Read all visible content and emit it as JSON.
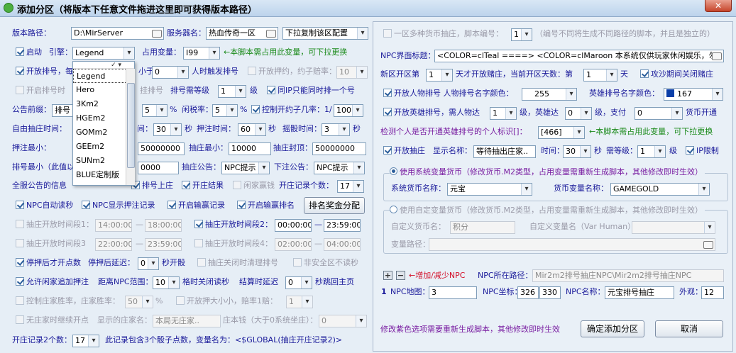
{
  "window": {
    "title": "添加分区（将版本下任意文件拖进这里即可获得版本路径）",
    "close": "✕"
  },
  "left": {
    "version_path_label": "版本路径：",
    "version_path": "D:\\MirServer",
    "server_name_label": "服务器名：",
    "server_name": "热血传奇一区",
    "copy_config": "下拉复制该区配置",
    "start_label": "启动",
    "engine_label": "引擎：",
    "engine": "Legend",
    "occupy_var_label": "占用变量：",
    "occupy_var": "I99",
    "occupy_note": "←本脚本需占用此变量，可下拉更换",
    "open_rank_label": "开放排号，每",
    "trigger_label": "小于",
    "trigger_value": "0",
    "trigger_note": "人时触发排号",
    "open_bet_label": "开放押约，约子赔率：",
    "bet_odds": "10",
    "enable_rank2_label": "开启排号时",
    "hang_label": "挂排号",
    "rank_level_label": "排号需等级",
    "rank_level": "1",
    "level_unit": "级",
    "same_ip_label": "同IP只能同时排一个号",
    "notice_label": "公告前缀：",
    "notice_value": "排号",
    "pct1": "5",
    "pct_unit": "%",
    "idle_rate_label": "闲税率：",
    "idle_rate": "5",
    "control_label": "控制开约子几率：1/",
    "control_value": "100",
    "free_label": "自由抽庄时间：",
    "time_label": "间：",
    "time1": "30",
    "sec": "秒",
    "bet_time_label": "押注时间：",
    "bet_time": "60",
    "shake_time_label": "摇骰时间：",
    "shake_time": "3",
    "min_bet_label": "押注最小：",
    "max_bet_value": "50000000",
    "min_grab_label": "抽庄最小：",
    "min_grab": "10000",
    "grab_cap_label": "抽庄封顶：",
    "grab_cap": "50000000",
    "rank_min_label": "排号最小（此值以",
    "rank_min_value": "0000",
    "grab_notice_label": "抽庄公告：",
    "grab_notice": "NPC提示",
    "bottom_notice_label": "下注公告：",
    "bottom_notice": "NPC提示",
    "all_notice_label": "全服公告的信息",
    "rank_on_label": "排号上庄",
    "result_label": "开庄结果",
    "idle_label": "闲家赢钱",
    "record_count_label": "开庄记录个数：",
    "record_count": "17",
    "npc_auto_label": "NPC自动读秒",
    "npc_show_label": "NPC显示押注记录",
    "win_record_label": "开启输赢记录",
    "win_rank_label": "开启输赢排名",
    "rank_award_btn": "排名奖金分配",
    "period1_label": "抽庄开放时间段1：",
    "p1a": "14:00:00",
    "p1b": "18:00:00",
    "period2_label": "抽庄开放时间段2：",
    "p2a": "00:00:00",
    "p2b": "23:59:00",
    "period3_label": "抽庄开放时间段3",
    "p3a": "22:00:00",
    "p3b": "23:59:00",
    "period4_label": "抽庄开放时间段4：",
    "p4a": "02:00:00",
    "p4b": "04:00:00",
    "dash": "—",
    "stop_label": "停押后才开点数",
    "delay_label": "停押后延迟：",
    "delay": "0",
    "delay_unit": "秒开骰",
    "grab_clear_label": "抽庄关闭时清理排号",
    "non_owner_label": "非安全区不读秒",
    "allow_idle_label": "允许闲家追加押注",
    "npc_range_label": "距离NPC范围：",
    "npc_range": "10",
    "range_unit": "格时关闭读秒",
    "settle_label": "结算时延迟",
    "settle": "0",
    "settle_unit": "秒跳回主页",
    "ctrl_winrate_label": "控制庄家胜率，庄家胜率：",
    "ctrl_winrate": "50",
    "pct": "%",
    "open_size_label": "开放押大小小，赔率1赔：",
    "open_size": "1",
    "no_dealer_label": "无庄家时继续开点",
    "show_dealer_label": "显示的庄家名：",
    "show_dealer": "本局无庄家..",
    "dealer_money_label": "庄本钱（大于0系统坐庄）：",
    "dealer_money": "0",
    "record2_label": "开庄记录2个数：",
    "record2": "17",
    "record2_note": "此记录包含3个骰子点数，变量名为：<$GLOBAL(抽庄开庄记录2)>",
    "engine_options": [
      "Legend",
      "Hero",
      "3Km2",
      "HGEm2",
      "GOMm2",
      "GEEm2",
      "SUNm2",
      "BLUE定制版"
    ]
  },
  "right": {
    "multi_label": "一区多种货币抽庄，脚本编号：",
    "multi_value": "1",
    "multi_note": "（编号不同将生成不同路径的脚本，并且是独立的）",
    "npc_title_label": "NPC界面标题：",
    "npc_title": "<COLOR=clTeal ====> <COLOR=clMaroon 本系统仅供玩家休闲娱乐，勿",
    "new_zone_label": "新区开区第",
    "new_zone": "1",
    "open_day_label": "天才开放赌庄，当前开区天数：第",
    "open_day": "1",
    "day": "天",
    "siege_label": "攻沙期间关闭赌庄",
    "open_human_label": "开放人物排号 人物排号名字颜色：",
    "human_color": "255",
    "hero_color_label": "英雄排号名字颜色：",
    "hero_color": "167",
    "hero_color_hex": "#0b3fa8",
    "open_hero_label": "开放英雄排号，需人物达",
    "hero_lv1": "1",
    "hero_lv_mid": "级，英雄达",
    "hero_lv2": "0",
    "hero_pay_label": "级，支付",
    "hero_pay": "0",
    "currency_open": "货币开通",
    "detect_label": "检测个人是否开通英雄排号的个人标识[]：",
    "detect_value": "[466]",
    "detect_note": "←本脚本需占用此变量，可下拉更换",
    "open_grab_label": "开放抽庄",
    "display_name_label": "显示名称：",
    "display_name": "等待抽出庄家..",
    "time_label": "时间：",
    "time_value": "30",
    "sec": "秒",
    "need_level_label": "需等级：",
    "need_level": "1",
    "level": "级",
    "ip_limit_label": "IP限制",
    "sys_currency_radio": "使用系统变量货币（修改货币.M2类型，占用变量需重新生成脚本，其他修改即时生效）",
    "sys_currency_name_label": "系统货币名称：",
    "sys_currency_name": "元宝",
    "currency_var_label": "货币变量名称：",
    "currency_var": "GAMEGOLD",
    "custom_currency_radio": "使用自定变量货币（修改货币.M2类型，占用变量需重新生成脚本，其他修改即时生效）",
    "custom_name_label": "自定义货币名：",
    "custom_name": "积分",
    "custom_var_label": "自定义变量名（Var Human）：",
    "custom_var": "",
    "var_path_label": "变量路径：",
    "var_path": "",
    "add_remove_label": "←增加/减少NPC",
    "npc_path_label": "NPC所在路径：",
    "npc_path": "Mir2m2排号抽庄NPC\\Mir2m2排号抽庄NPC",
    "row_index": "1",
    "npc_map_label": "NPC地图：",
    "npc_map": "3",
    "npc_coord_label": "NPC坐标：",
    "npc_x": "326",
    "npc_y": "330",
    "npc_name_label": "NPC名称：",
    "npc_name": "元宝排号抽庄",
    "appearance_label": "外观：",
    "appearance": "12",
    "footer_note": "修改紫色选项需要重新生成脚本，其他修改即时生效",
    "confirm_btn": "确定添加分区",
    "cancel_btn": "取消"
  }
}
